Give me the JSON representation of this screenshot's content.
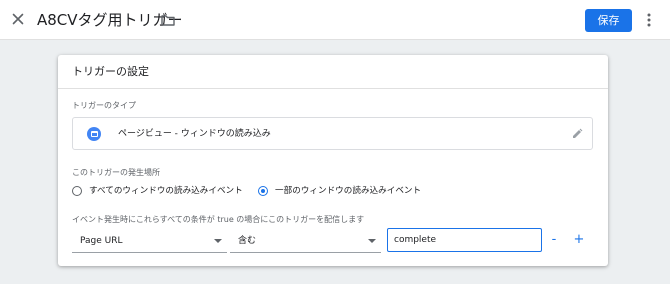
{
  "header": {
    "title": "A8CVタグ用トリガー",
    "save_label": "保存",
    "icons": {
      "close": "close-icon",
      "folder": "folder-icon",
      "more": "more-vert-icon"
    }
  },
  "card": {
    "title": "トリガーの設定",
    "trigger_type": {
      "label": "トリガーのタイプ",
      "value": "ページビュー - ウィンドウの読み込み",
      "icon": "page-view-icon",
      "edit_icon": "pencil-icon"
    },
    "fire_on": {
      "label": "このトリガーの発生場所",
      "options": [
        {
          "label": "すべてのウィンドウの読み込みイベント",
          "selected": false
        },
        {
          "label": "一部のウィンドウの読み込みイベント",
          "selected": true
        }
      ]
    },
    "condition": {
      "label": "イベント発生時にこれらすべての条件が true の場合にこのトリガーを配信します",
      "variable": "Page URL",
      "operator": "含む",
      "value": "complete",
      "remove_label": "-",
      "add_label": "+"
    }
  },
  "colors": {
    "accent": "#1a73e8",
    "background": "#eceff1",
    "card": "#ffffff",
    "type_icon": "#4285f4"
  }
}
